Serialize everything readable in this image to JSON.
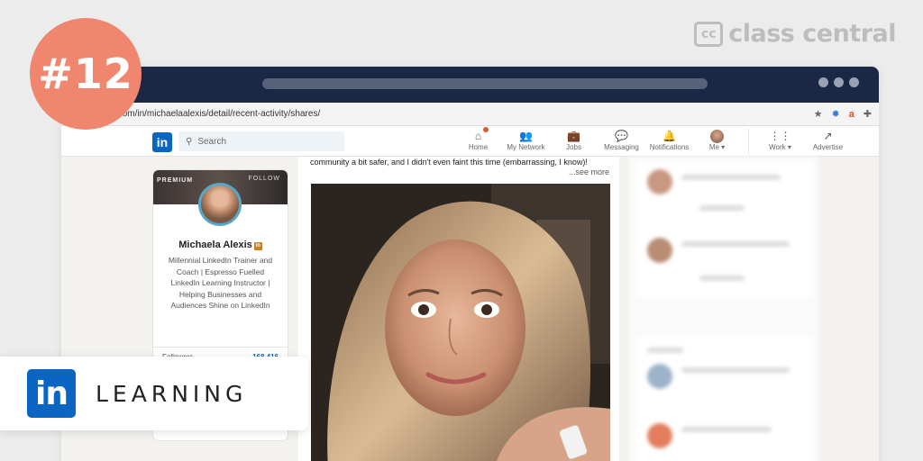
{
  "overlay": {
    "number_badge": "#12",
    "brand": {
      "mark": "cc",
      "name": "class central"
    },
    "learning_badge": {
      "logo": "in",
      "label": "LEARNING"
    }
  },
  "browser": {
    "url": "linkedin.com/in/michaelaalexis/detail/recent-activity/shares/"
  },
  "linkedin": {
    "logo": "in",
    "search_placeholder": "Search",
    "nav": [
      {
        "label": "Home",
        "icon": "home-icon"
      },
      {
        "label": "My Network",
        "icon": "network-icon"
      },
      {
        "label": "Jobs",
        "icon": "briefcase-icon"
      },
      {
        "label": "Messaging",
        "icon": "chat-icon"
      },
      {
        "label": "Notifications",
        "icon": "bell-icon"
      },
      {
        "label": "Me",
        "icon": "avatar"
      },
      {
        "label": "Work",
        "icon": "grid-icon"
      },
      {
        "label": "Advertise",
        "icon": "advertise-icon"
      }
    ],
    "profile": {
      "premium_label": "PREMIUM",
      "follow_label": "FOLLOW",
      "name": "Michaela Alexis",
      "headline": "Millennial LinkedIn Trainer and Coach | Espresso Fuelled LinkedIn Learning Instructor | Helping Businesses and Audiences Shine on LinkedIn",
      "stats": [
        {
          "label": "Followers",
          "value": "168,416"
        }
      ]
    },
    "post": {
      "text": "community a bit safer, and I didn't even faint this time (embarrassing, I know)!",
      "see_more": "...see more"
    }
  },
  "colors": {
    "linkedin_blue": "#0a66c2",
    "badge_coral": "#f0866e",
    "titlebar": "#1a2745"
  }
}
